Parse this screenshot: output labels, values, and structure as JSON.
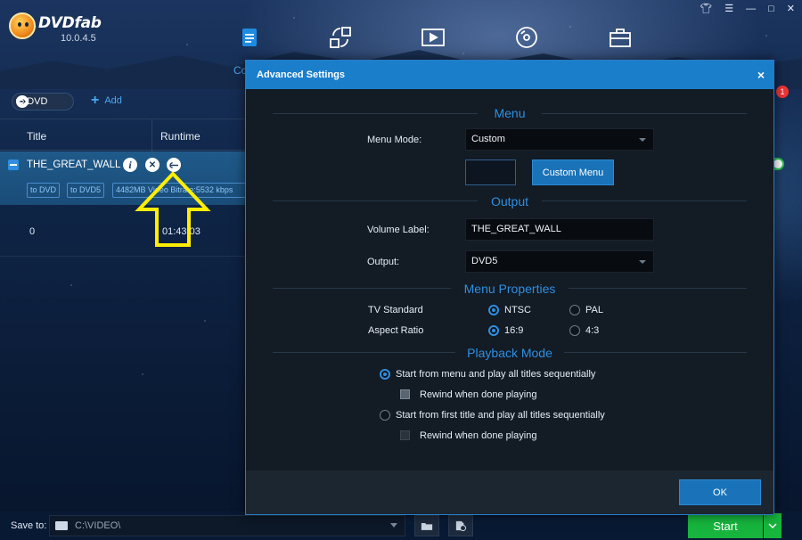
{
  "app": {
    "name": "DVDfab",
    "version": "10.0.4.5"
  },
  "header": {
    "nav_icons": [
      "copy-icon",
      "converter-icon",
      "video-icon",
      "disc-icon",
      "toolbox-icon"
    ],
    "partial_label": "Co",
    "window_controls": [
      "shirt-icon",
      "dropdown-icon",
      "minimize-icon",
      "maximize-icon",
      "close-icon"
    ]
  },
  "toolbar": {
    "to_dvd_label": "to DVD",
    "add_label": "Add"
  },
  "table": {
    "columns": [
      "Title",
      "Runtime"
    ],
    "selected_row": {
      "name": "THE_GREAT_WALL",
      "tags": [
        "to DVD",
        "to DVD5",
        "4482MB Video Bitrate:5532 kbps"
      ]
    },
    "rows": [
      {
        "num": "0",
        "runtime": "01:43:03"
      }
    ]
  },
  "dialog": {
    "title": "Advanced Settings",
    "close_glyph": "×",
    "menu": {
      "section_title": "Menu",
      "mode_label": "Menu Mode:",
      "mode_value": "Custom",
      "custom_menu_button": "Custom Menu"
    },
    "output": {
      "section_title": "Output",
      "volume_label_label": "Volume Label:",
      "volume_label_value": "THE_GREAT_WALL",
      "output_label": "Output:",
      "output_value": "DVD5"
    },
    "menu_properties": {
      "section_title": "Menu Properties",
      "tv_standard_label": "TV Standard",
      "tv_standard_options": [
        "NTSC",
        "PAL"
      ],
      "tv_standard_selected": "NTSC",
      "aspect_ratio_label": "Aspect Ratio",
      "aspect_ratio_options": [
        "16:9",
        "4:3"
      ],
      "aspect_ratio_selected": "16:9"
    },
    "playback_mode": {
      "section_title": "Playback Mode",
      "option1": "Start from menu and play all titles sequentially",
      "option1_rewind": "Rewind when done playing",
      "option2": "Start from first title and play all titles sequentially",
      "option2_rewind": "Rewind when done playing",
      "selected": "option1"
    },
    "ok_label": "OK"
  },
  "bottom": {
    "save_label": "Save to:",
    "save_path": "C:\\VIDEO\\",
    "start_label": "Start"
  },
  "badge_count": "1",
  "colors": {
    "accent": "#1a7ecb",
    "start_green": "#17b53d",
    "highlight_arrow": "#ffee00",
    "section_blue": "#2f8ee0"
  }
}
